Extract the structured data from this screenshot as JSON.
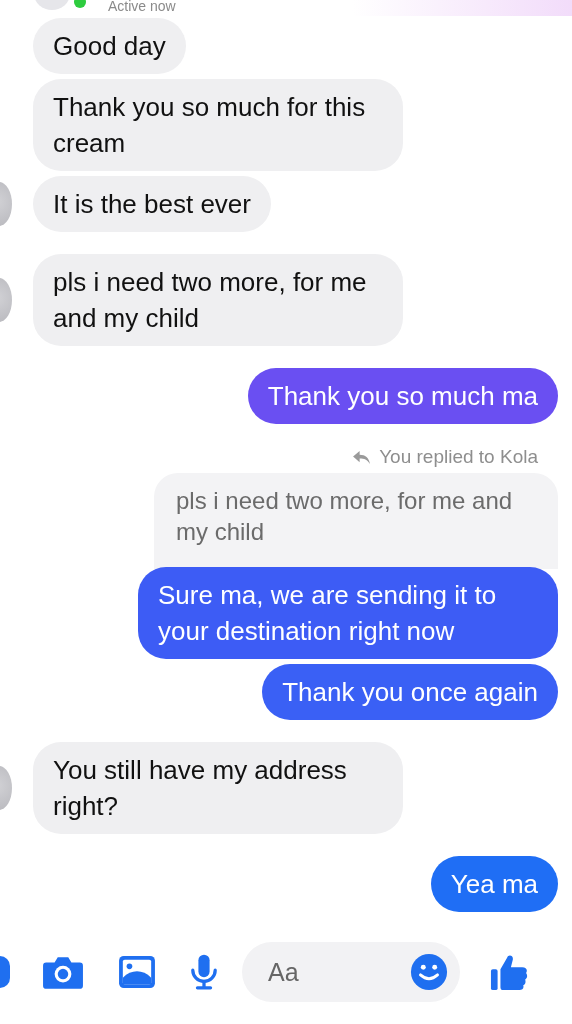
{
  "header": {
    "status": "Active now",
    "online": true
  },
  "messages": [
    {
      "kind": "incoming",
      "text": "Good day",
      "avatar": false
    },
    {
      "kind": "incoming",
      "text": "Thank you so much for this cream",
      "avatar": false
    },
    {
      "kind": "incoming",
      "text": "It is the best ever",
      "avatar": true
    },
    {
      "kind": "incoming",
      "text": "pls i need two more, for me and my child",
      "avatar": true
    },
    {
      "kind": "outgoing",
      "text": "Thank you so much ma",
      "color": "#6a4ff2"
    },
    {
      "kind": "reply_note",
      "text": "You replied to Kola"
    },
    {
      "kind": "quoted",
      "text": "pls i need two more, for me and my child"
    },
    {
      "kind": "outgoing",
      "text": "Sure ma, we are sending it to your destination right now",
      "color": "#3d5cf5"
    },
    {
      "kind": "outgoing",
      "text": "Thank you once again",
      "color": "#3a60f5"
    },
    {
      "kind": "incoming",
      "text": "You still have my address right?",
      "avatar": true
    },
    {
      "kind": "outgoing",
      "text": "Yea ma",
      "color": "#1f6ef5"
    }
  ],
  "composer": {
    "placeholder": "Aa"
  }
}
